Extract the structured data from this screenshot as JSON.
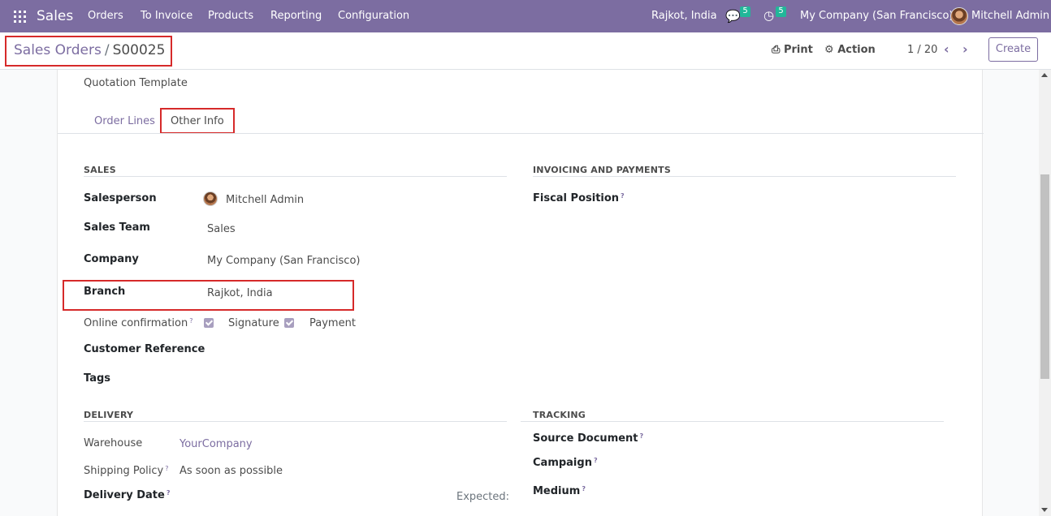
{
  "navbar": {
    "app_name": "Sales",
    "menu": [
      "Orders",
      "To Invoice",
      "Products",
      "Reporting",
      "Configuration"
    ],
    "branch": "Rajkot, India",
    "messages_count": "5",
    "activities_count": "5",
    "company": "My Company (San Francisco)",
    "user": "Mitchell Admin"
  },
  "breadcrumb": {
    "parent": "Sales Orders",
    "separator": "/",
    "current": "S00025"
  },
  "actions": {
    "print": "Print",
    "action": "Action",
    "pager": "1 / 20",
    "create": "Create"
  },
  "form": {
    "quotation_template_label": "Quotation Template",
    "tabs": [
      "Order Lines",
      "Other Info"
    ],
    "sales": {
      "title": "SALES",
      "salesperson_label": "Salesperson",
      "salesperson_value": "Mitchell Admin",
      "sales_team_label": "Sales Team",
      "sales_team_value": "Sales",
      "company_label": "Company",
      "company_value": "My Company (San Francisco)",
      "branch_label": "Branch",
      "branch_value": "Rajkot, India",
      "online_confirmation_label": "Online confirmation",
      "signature_label": "Signature",
      "payment_label": "Payment",
      "customer_reference_label": "Customer Reference",
      "tags_label": "Tags"
    },
    "invoicing": {
      "title": "INVOICING AND PAYMENTS",
      "fiscal_position_label": "Fiscal Position"
    },
    "delivery": {
      "title": "DELIVERY",
      "warehouse_label": "Warehouse",
      "warehouse_value": "YourCompany",
      "shipping_policy_label": "Shipping Policy",
      "shipping_policy_value": "As soon as possible",
      "delivery_date_label": "Delivery Date",
      "expected_label": "Expected:"
    },
    "tracking": {
      "title": "TRACKING",
      "source_document_label": "Source Document",
      "campaign_label": "Campaign",
      "medium_label": "Medium"
    },
    "help_mark": "?"
  },
  "colors": {
    "brand": "#7c6da1",
    "highlight": "#d62a2a",
    "badge": "#21b799"
  }
}
